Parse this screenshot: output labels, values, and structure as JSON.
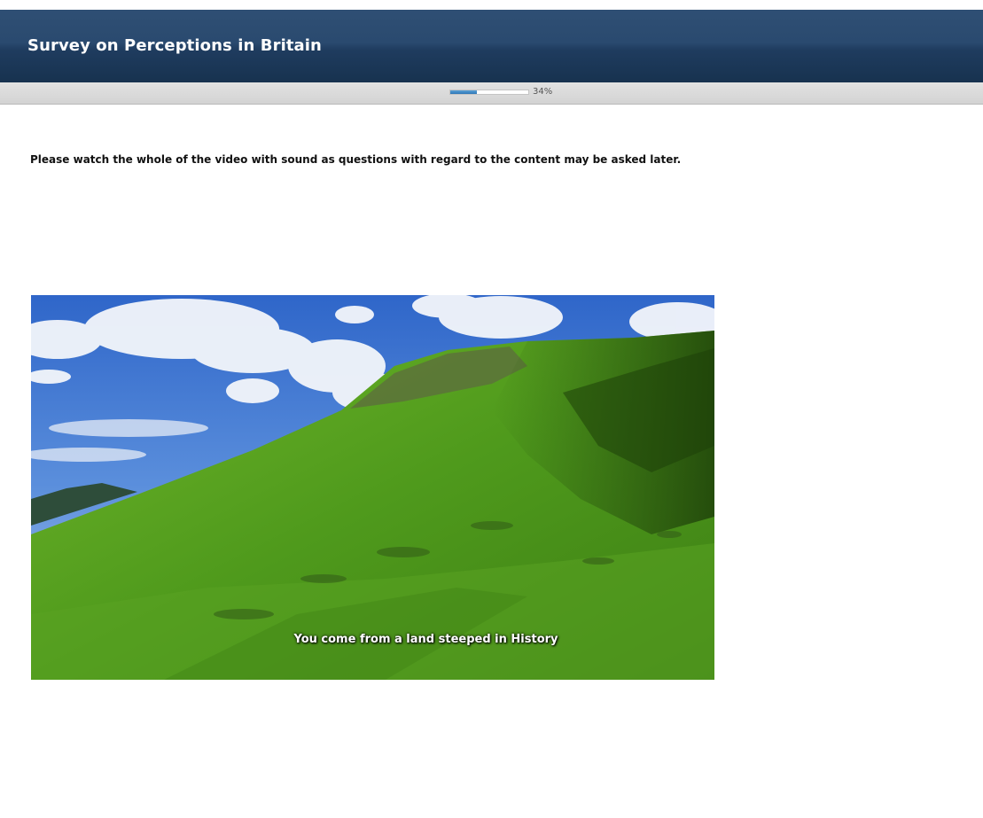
{
  "survey": {
    "title": "Survey on Perceptions in Britain"
  },
  "progress": {
    "percent": 34,
    "label": "34%"
  },
  "content": {
    "instruction": "Please watch the whole of the video with sound as questions with regard to the content may be asked later."
  },
  "video": {
    "subtitle": "You come from a land steeped in History",
    "scene": "green-hillside-landscape"
  }
}
